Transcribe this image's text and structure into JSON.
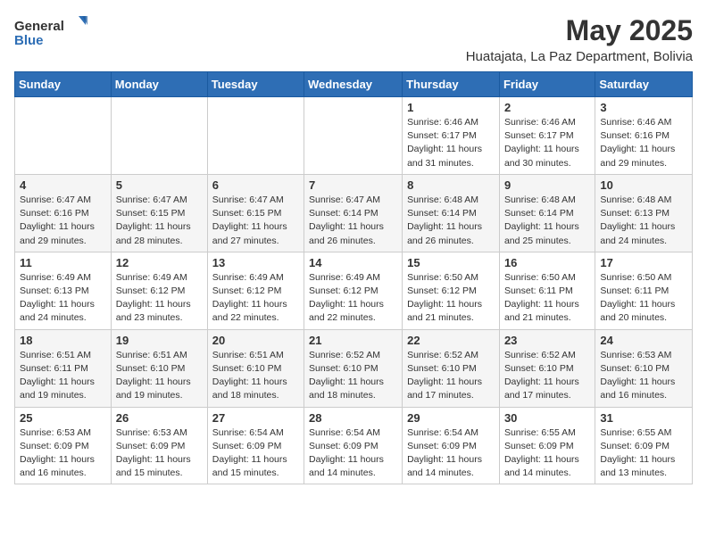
{
  "header": {
    "logo_general": "General",
    "logo_blue": "Blue",
    "title": "May 2025",
    "subtitle": "Huatajata, La Paz Department, Bolivia"
  },
  "weekdays": [
    "Sunday",
    "Monday",
    "Tuesday",
    "Wednesday",
    "Thursday",
    "Friday",
    "Saturday"
  ],
  "weeks": [
    [
      {
        "day": "",
        "info": ""
      },
      {
        "day": "",
        "info": ""
      },
      {
        "day": "",
        "info": ""
      },
      {
        "day": "",
        "info": ""
      },
      {
        "day": "1",
        "info": "Sunrise: 6:46 AM\nSunset: 6:17 PM\nDaylight: 11 hours and 31 minutes."
      },
      {
        "day": "2",
        "info": "Sunrise: 6:46 AM\nSunset: 6:17 PM\nDaylight: 11 hours and 30 minutes."
      },
      {
        "day": "3",
        "info": "Sunrise: 6:46 AM\nSunset: 6:16 PM\nDaylight: 11 hours and 29 minutes."
      }
    ],
    [
      {
        "day": "4",
        "info": "Sunrise: 6:47 AM\nSunset: 6:16 PM\nDaylight: 11 hours and 29 minutes."
      },
      {
        "day": "5",
        "info": "Sunrise: 6:47 AM\nSunset: 6:15 PM\nDaylight: 11 hours and 28 minutes."
      },
      {
        "day": "6",
        "info": "Sunrise: 6:47 AM\nSunset: 6:15 PM\nDaylight: 11 hours and 27 minutes."
      },
      {
        "day": "7",
        "info": "Sunrise: 6:47 AM\nSunset: 6:14 PM\nDaylight: 11 hours and 26 minutes."
      },
      {
        "day": "8",
        "info": "Sunrise: 6:48 AM\nSunset: 6:14 PM\nDaylight: 11 hours and 26 minutes."
      },
      {
        "day": "9",
        "info": "Sunrise: 6:48 AM\nSunset: 6:14 PM\nDaylight: 11 hours and 25 minutes."
      },
      {
        "day": "10",
        "info": "Sunrise: 6:48 AM\nSunset: 6:13 PM\nDaylight: 11 hours and 24 minutes."
      }
    ],
    [
      {
        "day": "11",
        "info": "Sunrise: 6:49 AM\nSunset: 6:13 PM\nDaylight: 11 hours and 24 minutes."
      },
      {
        "day": "12",
        "info": "Sunrise: 6:49 AM\nSunset: 6:12 PM\nDaylight: 11 hours and 23 minutes."
      },
      {
        "day": "13",
        "info": "Sunrise: 6:49 AM\nSunset: 6:12 PM\nDaylight: 11 hours and 22 minutes."
      },
      {
        "day": "14",
        "info": "Sunrise: 6:49 AM\nSunset: 6:12 PM\nDaylight: 11 hours and 22 minutes."
      },
      {
        "day": "15",
        "info": "Sunrise: 6:50 AM\nSunset: 6:12 PM\nDaylight: 11 hours and 21 minutes."
      },
      {
        "day": "16",
        "info": "Sunrise: 6:50 AM\nSunset: 6:11 PM\nDaylight: 11 hours and 21 minutes."
      },
      {
        "day": "17",
        "info": "Sunrise: 6:50 AM\nSunset: 6:11 PM\nDaylight: 11 hours and 20 minutes."
      }
    ],
    [
      {
        "day": "18",
        "info": "Sunrise: 6:51 AM\nSunset: 6:11 PM\nDaylight: 11 hours and 19 minutes."
      },
      {
        "day": "19",
        "info": "Sunrise: 6:51 AM\nSunset: 6:10 PM\nDaylight: 11 hours and 19 minutes."
      },
      {
        "day": "20",
        "info": "Sunrise: 6:51 AM\nSunset: 6:10 PM\nDaylight: 11 hours and 18 minutes."
      },
      {
        "day": "21",
        "info": "Sunrise: 6:52 AM\nSunset: 6:10 PM\nDaylight: 11 hours and 18 minutes."
      },
      {
        "day": "22",
        "info": "Sunrise: 6:52 AM\nSunset: 6:10 PM\nDaylight: 11 hours and 17 minutes."
      },
      {
        "day": "23",
        "info": "Sunrise: 6:52 AM\nSunset: 6:10 PM\nDaylight: 11 hours and 17 minutes."
      },
      {
        "day": "24",
        "info": "Sunrise: 6:53 AM\nSunset: 6:10 PM\nDaylight: 11 hours and 16 minutes."
      }
    ],
    [
      {
        "day": "25",
        "info": "Sunrise: 6:53 AM\nSunset: 6:09 PM\nDaylight: 11 hours and 16 minutes."
      },
      {
        "day": "26",
        "info": "Sunrise: 6:53 AM\nSunset: 6:09 PM\nDaylight: 11 hours and 15 minutes."
      },
      {
        "day": "27",
        "info": "Sunrise: 6:54 AM\nSunset: 6:09 PM\nDaylight: 11 hours and 15 minutes."
      },
      {
        "day": "28",
        "info": "Sunrise: 6:54 AM\nSunset: 6:09 PM\nDaylight: 11 hours and 14 minutes."
      },
      {
        "day": "29",
        "info": "Sunrise: 6:54 AM\nSunset: 6:09 PM\nDaylight: 11 hours and 14 minutes."
      },
      {
        "day": "30",
        "info": "Sunrise: 6:55 AM\nSunset: 6:09 PM\nDaylight: 11 hours and 14 minutes."
      },
      {
        "day": "31",
        "info": "Sunrise: 6:55 AM\nSunset: 6:09 PM\nDaylight: 11 hours and 13 minutes."
      }
    ]
  ]
}
